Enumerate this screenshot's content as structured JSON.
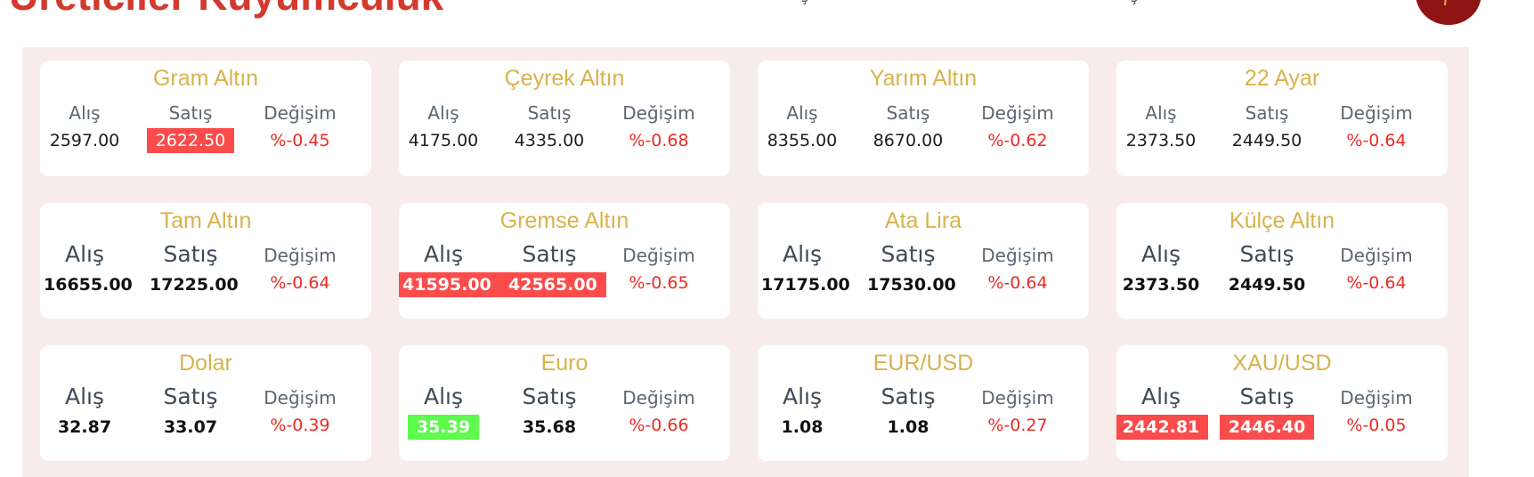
{
  "header": {
    "brand": "Üreticiler Kuyumculuk",
    "text_1": "ş",
    "text_2": "ş"
  },
  "labels": {
    "buy": "Alış",
    "sell": "Satış",
    "change": "Değişim"
  },
  "colors": {
    "title": "#d8b24c",
    "down": "#fb4b4b",
    "up": "#5dfb4b",
    "change_text": "#ef2a24",
    "panel": "#f8eceb"
  },
  "cards": [
    {
      "title": "Gram Altın",
      "style": "small",
      "buy": "2597.00",
      "buy_state": "none",
      "sell": "2622.50",
      "sell_state": "down",
      "change": "%-0.45"
    },
    {
      "title": "Çeyrek Altın",
      "style": "small",
      "buy": "4175.00",
      "buy_state": "none",
      "sell": "4335.00",
      "sell_state": "none",
      "change": "%-0.68"
    },
    {
      "title": "Yarım Altın",
      "style": "small",
      "buy": "8355.00",
      "buy_state": "none",
      "sell": "8670.00",
      "sell_state": "none",
      "change": "%-0.62"
    },
    {
      "title": "22 Ayar",
      "style": "small",
      "buy": "2373.50",
      "buy_state": "none",
      "sell": "2449.50",
      "sell_state": "none",
      "change": "%-0.64"
    },
    {
      "title": "Tam Altın",
      "style": "large",
      "buy": "16655.00",
      "buy_state": "none",
      "sell": "17225.00",
      "sell_state": "none",
      "change": "%-0.64"
    },
    {
      "title": "Gremse Altın",
      "style": "large",
      "buy": "41595.00",
      "buy_state": "down",
      "sell": "42565.00",
      "sell_state": "down",
      "change": "%-0.65"
    },
    {
      "title": "Ata Lira",
      "style": "large",
      "buy": "17175.00",
      "buy_state": "none",
      "sell": "17530.00",
      "sell_state": "none",
      "change": "%-0.64"
    },
    {
      "title": "Külçe Altın",
      "style": "large",
      "buy": "2373.50",
      "buy_state": "none",
      "sell": "2449.50",
      "sell_state": "none",
      "change": "%-0.64"
    },
    {
      "title": "Dolar",
      "style": "large",
      "buy": "32.87",
      "buy_state": "none",
      "sell": "33.07",
      "sell_state": "none",
      "change": "%-0.39"
    },
    {
      "title": "Euro",
      "style": "large",
      "buy": "35.39",
      "buy_state": "up",
      "sell": "35.68",
      "sell_state": "none",
      "change": "%-0.66"
    },
    {
      "title": "EUR/USD",
      "style": "large",
      "buy": "1.08",
      "buy_state": "none",
      "sell": "1.08",
      "sell_state": "none",
      "change": "%-0.27"
    },
    {
      "title": "XAU/USD",
      "style": "large",
      "buy": "2442.81",
      "buy_state": "down",
      "sell": "2446.40",
      "sell_state": "down",
      "change": "%-0.05"
    }
  ]
}
